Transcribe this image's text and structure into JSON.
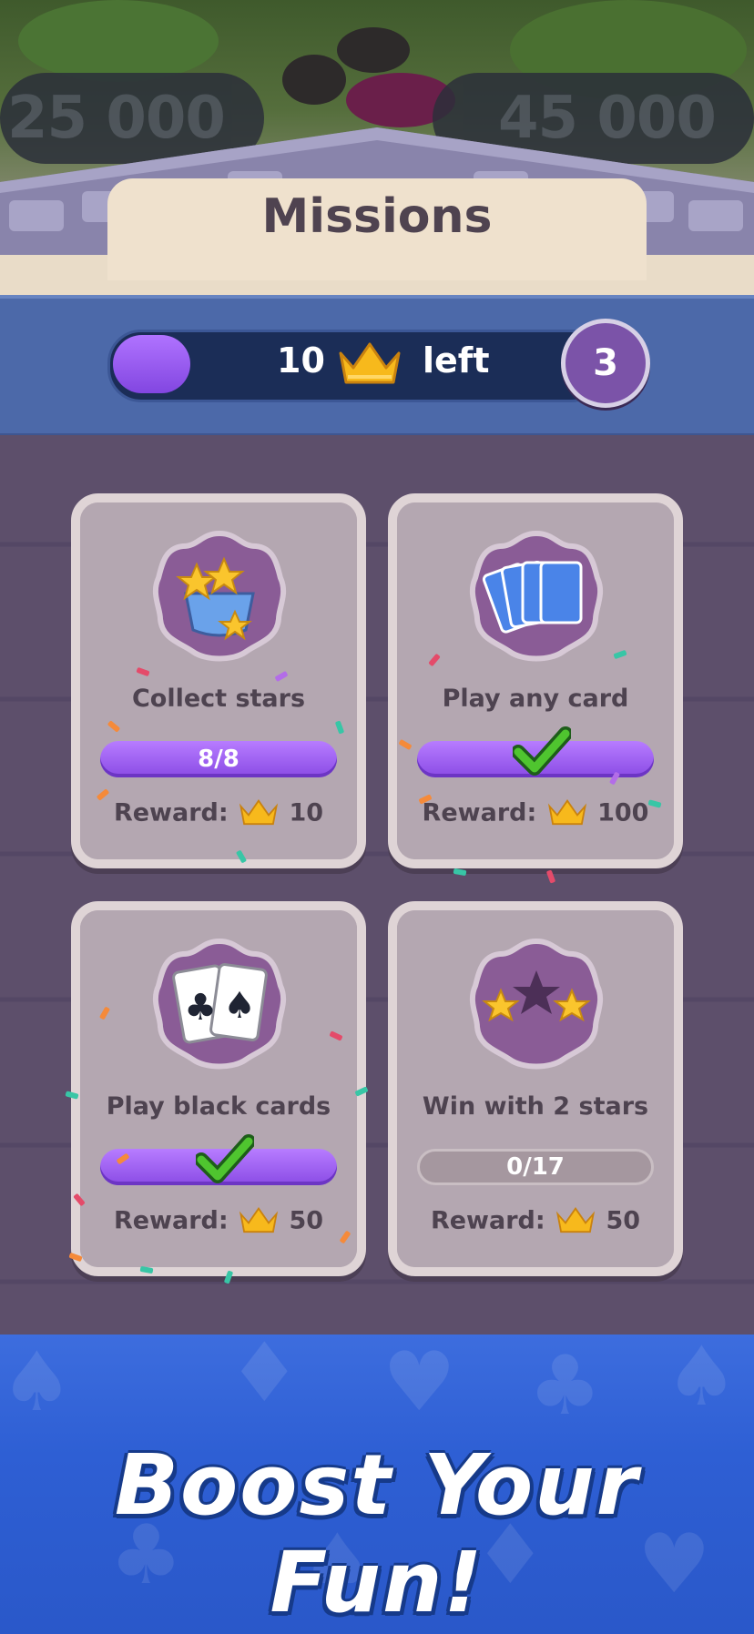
{
  "header": {
    "score_left": "25 000",
    "score_right": "45 000",
    "title": "Missions"
  },
  "progress": {
    "count": "10",
    "suffix": "left",
    "level": "3",
    "fill_fraction": 0.16
  },
  "missions": [
    {
      "label": "Collect stars",
      "progress_text": "8/8",
      "reward_prefix": "Reward:",
      "reward_value": "10",
      "completed": true,
      "icon": "star-bowl-icon"
    },
    {
      "label": "Play any card",
      "progress_text": "",
      "reward_prefix": "Reward:",
      "reward_value": "100",
      "completed": true,
      "icon": "card-fan-icon"
    },
    {
      "label": "Play black cards",
      "progress_text": "",
      "reward_prefix": "Reward:",
      "reward_value": "50",
      "completed": true,
      "icon": "club-spade-cards-icon"
    },
    {
      "label": "Win with 2 stars",
      "progress_text": "0/17",
      "reward_prefix": "Reward:",
      "reward_value": "50",
      "completed": false,
      "icon": "two-stars-icon"
    }
  ],
  "footer": {
    "slogan": "Boost Your Fun!"
  },
  "colors": {
    "accent_purple": "#8a4be5",
    "crown_gold": "#f7b91c",
    "footer_blue": "#2e5fd4"
  }
}
